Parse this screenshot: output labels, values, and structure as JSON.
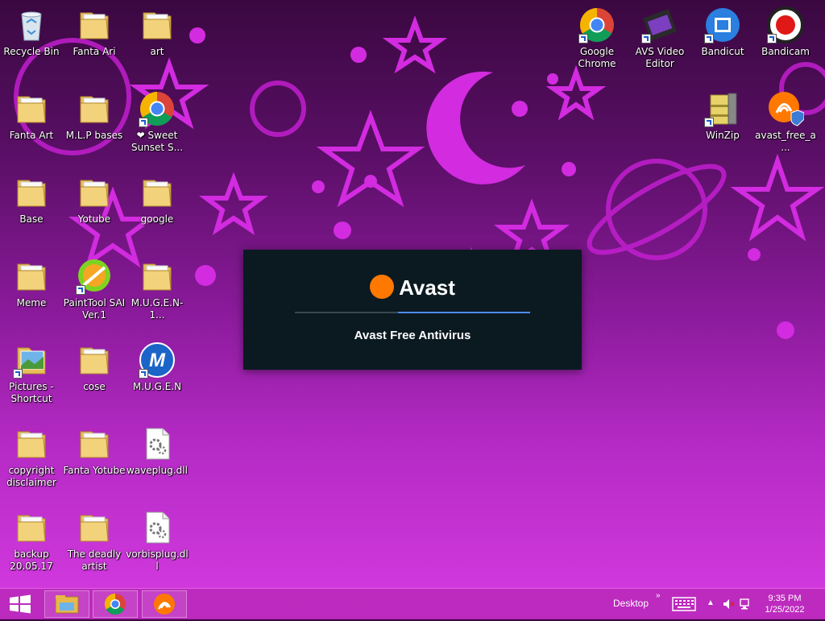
{
  "desktop": {
    "left_icons": [
      {
        "name": "recycle-bin",
        "label": "Recycle Bin",
        "icon": "recycle-bin-icon",
        "shortcut": false
      },
      {
        "name": "fanta-ari",
        "label": "Fanta Ari",
        "icon": "folder-icon",
        "shortcut": false
      },
      {
        "name": "art",
        "label": "art",
        "icon": "folder-icon",
        "shortcut": false
      },
      {
        "name": "fanta-art",
        "label": "Fanta Art",
        "icon": "folder-icon",
        "shortcut": false
      },
      {
        "name": "mlp-bases",
        "label": "M.L.P bases",
        "icon": "folder-icon",
        "shortcut": false
      },
      {
        "name": "sweet-sunset",
        "label": "❤ Sweet Sunset S...",
        "icon": "chrome-icon",
        "shortcut": true
      },
      {
        "name": "base",
        "label": "Base",
        "icon": "folder-icon",
        "shortcut": false
      },
      {
        "name": "yotube",
        "label": "Yotube",
        "icon": "folder-icon",
        "shortcut": false
      },
      {
        "name": "google",
        "label": "google",
        "icon": "folder-icon",
        "shortcut": false
      },
      {
        "name": "meme",
        "label": "Meme",
        "icon": "folder-icon",
        "shortcut": false
      },
      {
        "name": "painttool-sai",
        "label": "PaintTool SAI Ver.1",
        "icon": "painttool-icon",
        "shortcut": true
      },
      {
        "name": "mugen-1",
        "label": "M.U.G.E.N-1...",
        "icon": "folder-icon",
        "shortcut": false
      },
      {
        "name": "pictures-shortcut",
        "label": "Pictures - Shortcut",
        "icon": "pictures-icon",
        "shortcut": true
      },
      {
        "name": "cose",
        "label": "cose",
        "icon": "folder-icon",
        "shortcut": false
      },
      {
        "name": "mugen",
        "label": "M.U.G.E.N",
        "icon": "mugen-icon",
        "shortcut": true
      },
      {
        "name": "copyright-disclaimer",
        "label": "copyright disclaimer",
        "icon": "folder-icon",
        "shortcut": false
      },
      {
        "name": "fanta-yotube",
        "label": "Fanta Yotube",
        "icon": "folder-icon",
        "shortcut": false
      },
      {
        "name": "waveplug",
        "label": "waveplug.dll",
        "icon": "dll-file-icon",
        "shortcut": false
      },
      {
        "name": "backup",
        "label": "backup 20.05.17",
        "icon": "folder-icon",
        "shortcut": false
      },
      {
        "name": "deadly-artist",
        "label": "The deadly artist",
        "icon": "folder-icon",
        "shortcut": false
      },
      {
        "name": "vorbisplug",
        "label": "vorbisplug.dll",
        "icon": "dll-file-icon",
        "shortcut": false
      }
    ],
    "right_icons": [
      {
        "name": "google-chrome",
        "label": "Google Chrome",
        "icon": "chrome-icon",
        "shortcut": true
      },
      {
        "name": "avs-video-editor",
        "label": "AVS Video Editor",
        "icon": "avs-icon",
        "shortcut": true
      },
      {
        "name": "bandicut",
        "label": "Bandicut",
        "icon": "bandicut-icon",
        "shortcut": true
      },
      {
        "name": "bandicam",
        "label": "Bandicam",
        "icon": "bandicam-icon",
        "shortcut": true
      },
      {
        "name": "winzip",
        "label": "WinZip",
        "icon": "winzip-icon",
        "shortcut": true
      },
      {
        "name": "avast-free",
        "label": "avast_free_a...",
        "icon": "avast-installer-icon",
        "shortcut": false
      }
    ]
  },
  "splash": {
    "brand": "Avast",
    "product": "Avast Free Antivirus",
    "progress": 0.56
  },
  "taskbar": {
    "start_icon": "windows-start-icon",
    "pinned": [
      "file-explorer-icon",
      "chrome-icon",
      "avast-icon"
    ],
    "desktop_label": "Desktop",
    "time": "9:35 PM",
    "date": "1/25/2022"
  },
  "colors": {
    "taskbar": "#ba28ba",
    "avast_orange": "#ff7800",
    "progress_blue": "#4c8bff",
    "splash_bg": "#0b1a21"
  }
}
